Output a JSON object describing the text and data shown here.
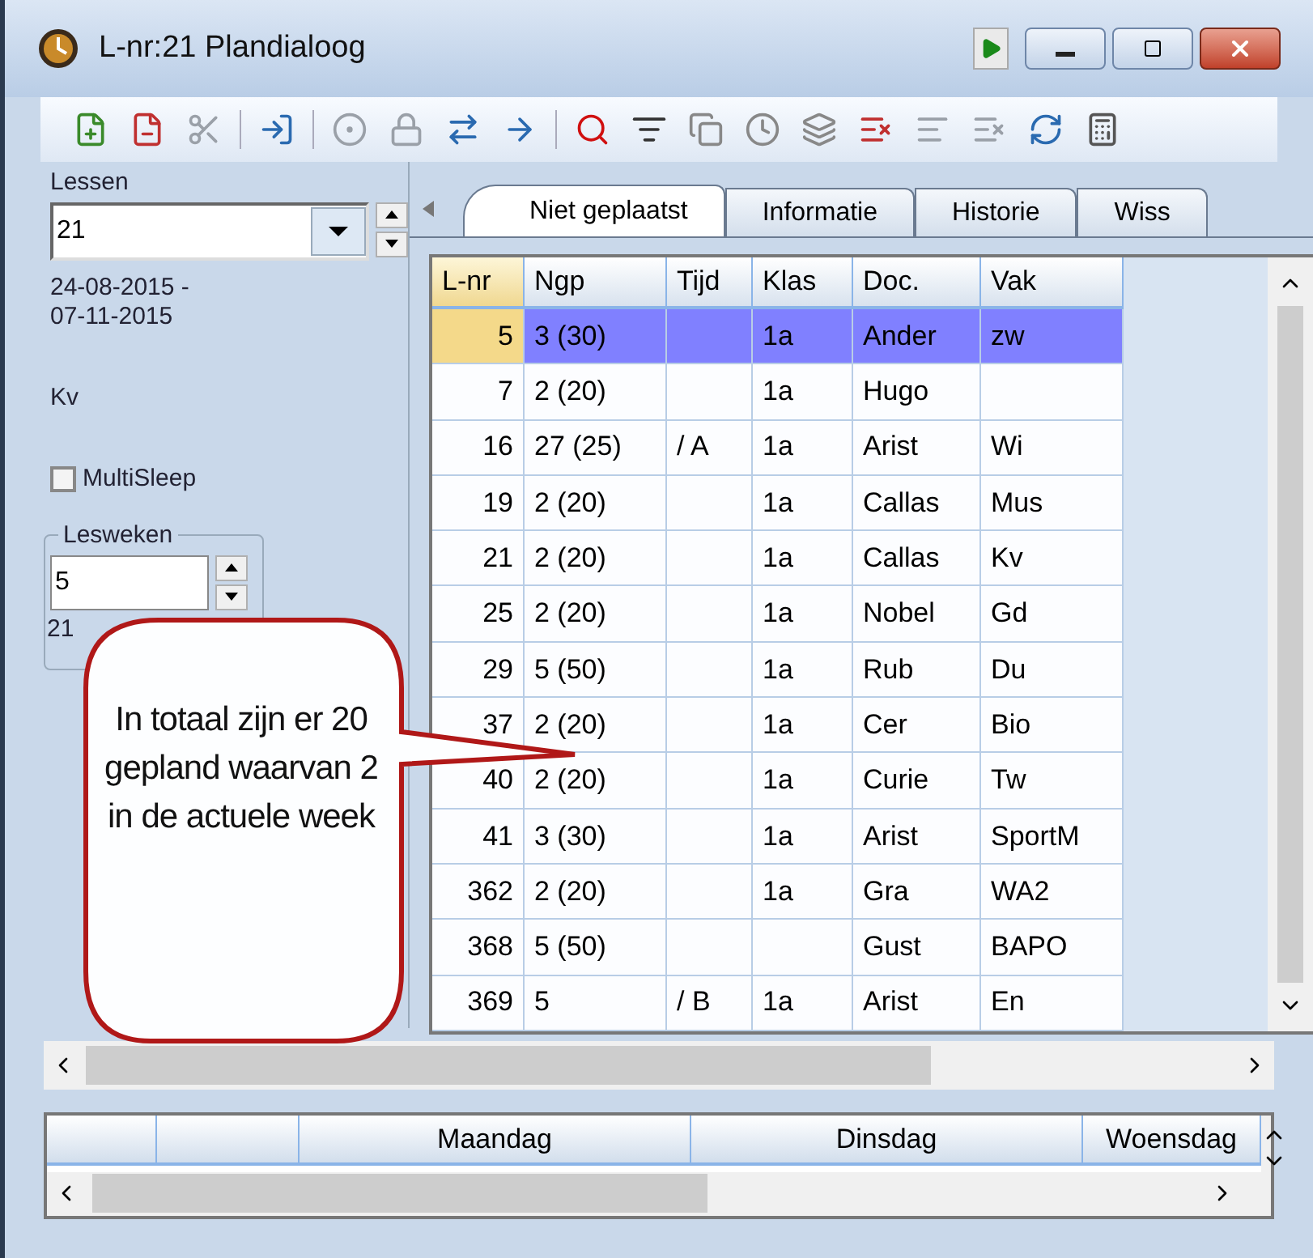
{
  "window": {
    "title": "L-nr:21  Plandialoog"
  },
  "left_panel": {
    "lessen_label": "Lessen",
    "lessen_value": "21",
    "date_from": "24-08-2015 -",
    "date_to": "07-11-2015",
    "subject": "Kv",
    "multisleep": {
      "label": "MultiSleep",
      "checked": false
    },
    "lesweken": {
      "label": "Lesweken",
      "value": "5",
      "count": "21"
    }
  },
  "tabs": [
    {
      "label": "Niet geplaatst",
      "selected": true
    },
    {
      "label": "Informatie",
      "selected": false
    },
    {
      "label": "Historie",
      "selected": false
    },
    {
      "label": "Wiss",
      "selected": false
    }
  ],
  "table": {
    "columns": [
      "L-nr",
      "Ngp",
      "Tijd",
      "Klas",
      "Doc.",
      "Vak"
    ],
    "rows": [
      {
        "cells": [
          "5",
          "3 (30)",
          "",
          "1a",
          "Ander",
          "zw"
        ],
        "selected": true
      },
      {
        "cells": [
          "7",
          "2 (20)",
          "",
          "1a",
          "Hugo",
          ""
        ],
        "selected": false
      },
      {
        "cells": [
          "16",
          "27 (25)",
          "/ A",
          "1a",
          "Arist",
          "Wi"
        ],
        "selected": false
      },
      {
        "cells": [
          "19",
          "2 (20)",
          "",
          "1a",
          "Callas",
          "Mus"
        ],
        "selected": false
      },
      {
        "cells": [
          "21",
          "2 (20)",
          "",
          "1a",
          "Callas",
          "Kv"
        ],
        "selected": false
      },
      {
        "cells": [
          "25",
          "2 (20)",
          "",
          "1a",
          "Nobel",
          "Gd"
        ],
        "selected": false
      },
      {
        "cells": [
          "29",
          "5 (50)",
          "",
          "1a",
          "Rub",
          "Du"
        ],
        "selected": false
      },
      {
        "cells": [
          "37",
          "2 (20)",
          "",
          "1a",
          "Cer",
          "Bio"
        ],
        "selected": false
      },
      {
        "cells": [
          "40",
          "2 (20)",
          "",
          "1a",
          "Curie",
          "Tw"
        ],
        "selected": false
      },
      {
        "cells": [
          "41",
          "3 (30)",
          "",
          "1a",
          "Arist",
          "SportM"
        ],
        "selected": false
      },
      {
        "cells": [
          "362",
          "2 (20)",
          "",
          "1a",
          "Gra",
          "WA2"
        ],
        "selected": false
      },
      {
        "cells": [
          "368",
          "5 (50)",
          "",
          "",
          "Gust",
          "BAPO"
        ],
        "selected": false
      },
      {
        "cells": [
          "369",
          "5",
          "/ B",
          "1a",
          "Arist",
          "En"
        ],
        "selected": false
      }
    ]
  },
  "schedule": {
    "days": [
      "Maandag",
      "Dinsdag",
      "Woensdag"
    ]
  },
  "callout": {
    "text": "In totaal zijn er 20 gepland waarvan 2 in de actuele week"
  }
}
